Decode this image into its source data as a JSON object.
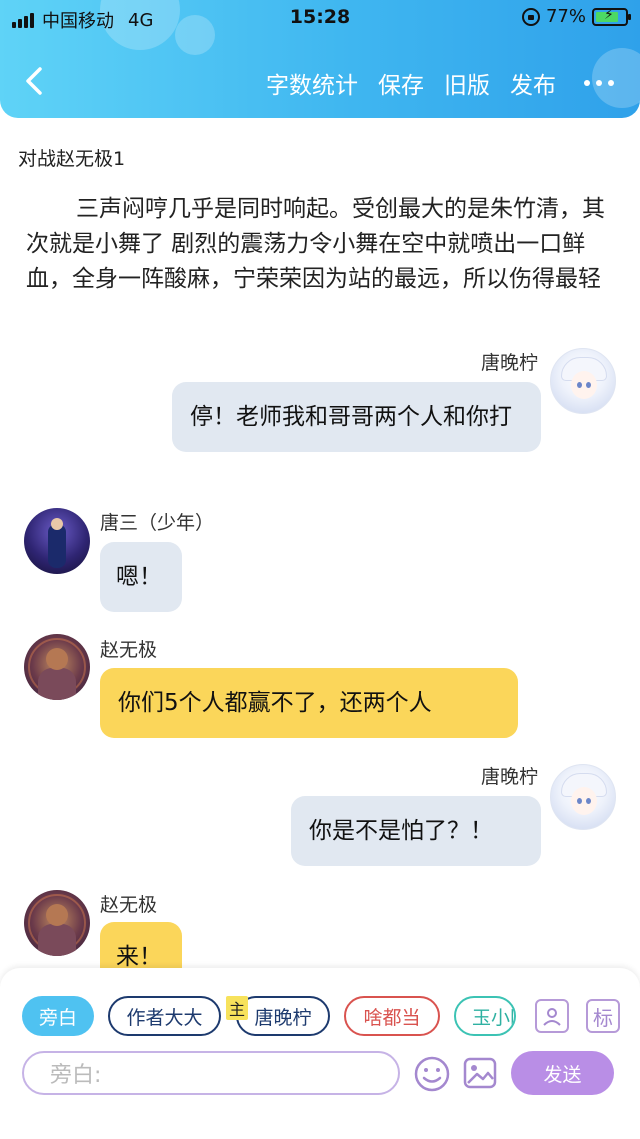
{
  "status_bar": {
    "carrier": "中国移动",
    "network": "4G",
    "time": "15:28",
    "battery_percent": "77%",
    "battery_level": 0.77
  },
  "nav": {
    "items": [
      "字数统计",
      "保存",
      "旧版",
      "发布"
    ]
  },
  "document": {
    "title": "对战赵无极1",
    "narration": "三声闷哼几乎是同时响起。受创最大的是朱竹清，其次就是小舞了 剧烈的震荡力令小舞在空中就喷出一口鲜血，全身一阵酸麻，宁荣荣因为站的最远，所以伤得最轻"
  },
  "messages": [
    {
      "speaker": "唐晚柠",
      "side": "right",
      "text": "停！老师我和哥哥两个人和你打",
      "bubble_color": "#e1e8f1"
    },
    {
      "speaker": "唐三（少年）",
      "side": "left",
      "text": "嗯！",
      "bubble_color": "#e1e8f1"
    },
    {
      "speaker": "赵无极",
      "side": "left",
      "text": "你们5个人都赢不了，还两个人",
      "bubble_color": "#fbd65a"
    },
    {
      "speaker": "唐晚柠",
      "side": "right",
      "text": "你是不是怕了？！",
      "bubble_color": "#e1e8f1"
    },
    {
      "speaker": "赵无极",
      "side": "left",
      "text": "来！",
      "bubble_color": "#fbd65a"
    }
  ],
  "composer": {
    "roles": [
      "旁白",
      "作者大大",
      "唐晚柠",
      "啥都当",
      "玉小刚"
    ],
    "main_badge": "主",
    "tag_label": "标",
    "input_placeholder": "旁白:",
    "send_label": "发送"
  },
  "colors": {
    "header_gradient_start": "#5fd3f7",
    "header_gradient_end": "#2fa1ea",
    "send_button": "#b98ee6",
    "active_chip": "#4fc2f1"
  }
}
